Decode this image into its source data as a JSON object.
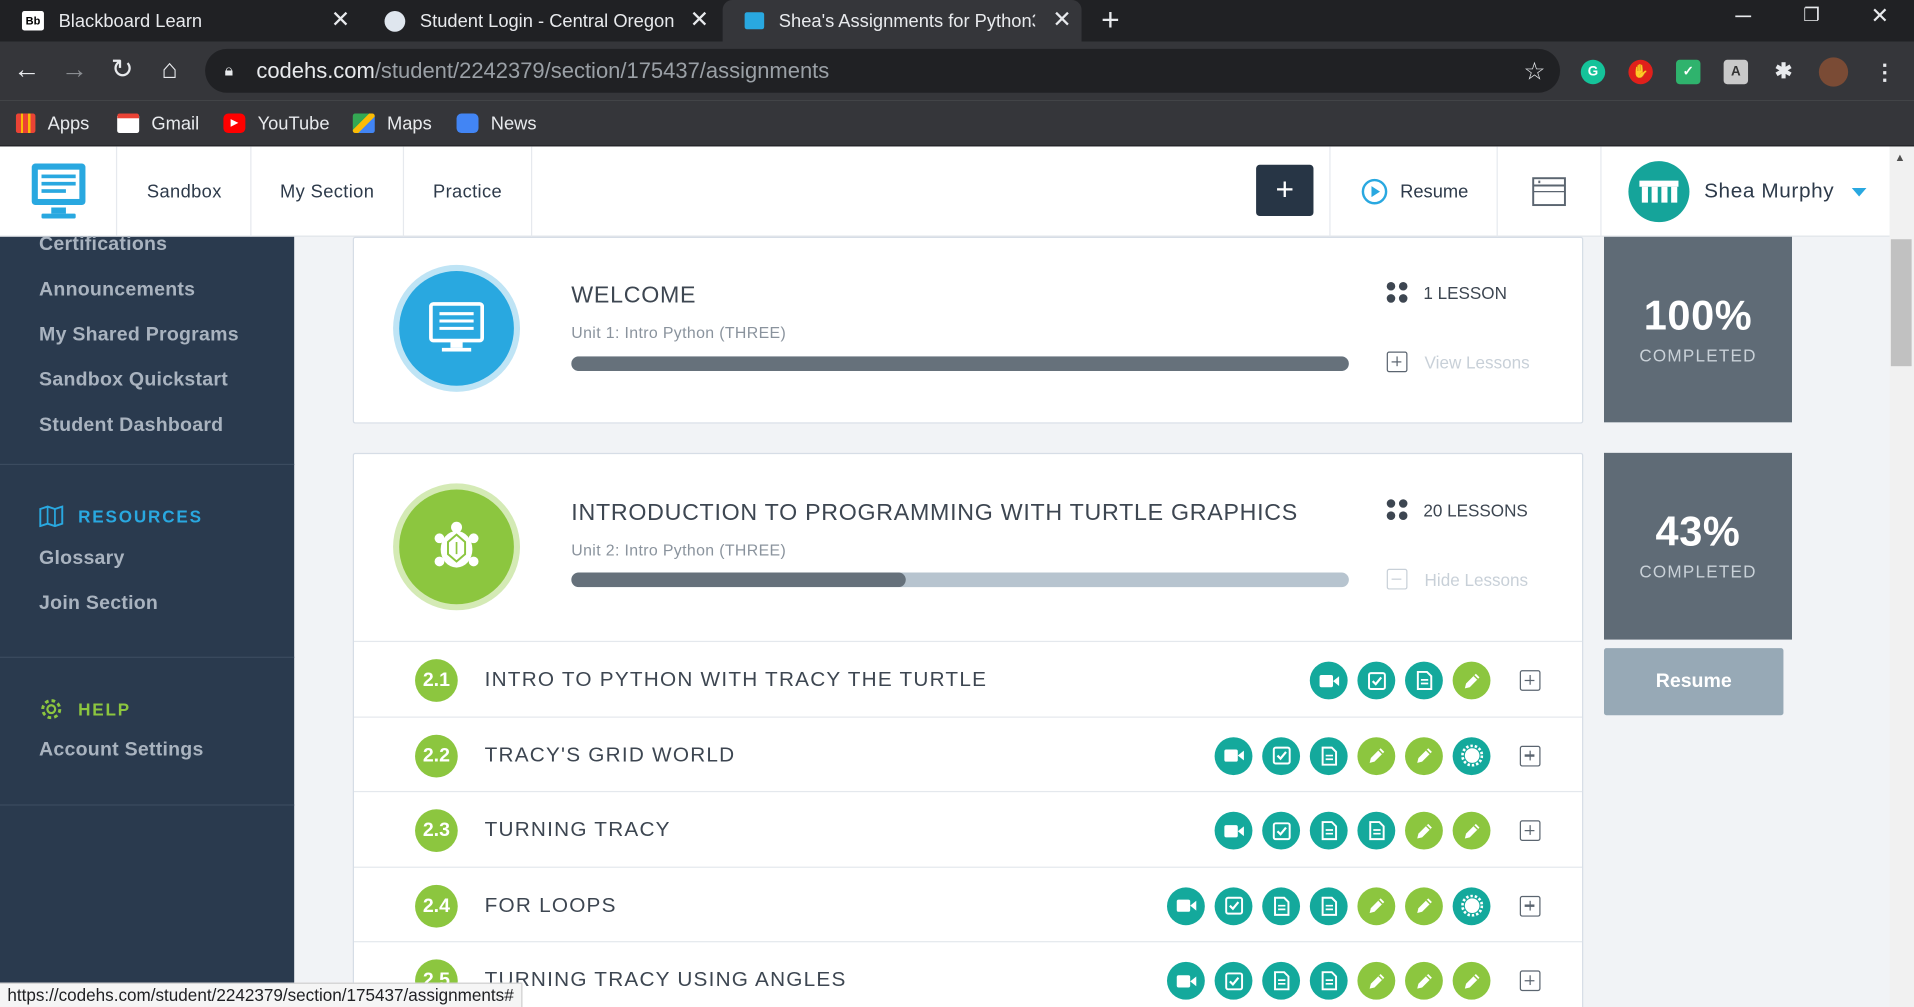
{
  "browser": {
    "tabs": [
      {
        "title": "Blackboard Learn",
        "favicon": "Bb"
      },
      {
        "title": "Student Login - Central Oregon C",
        "favicon": "globe"
      },
      {
        "title": "Shea's Assignments for Python3 |",
        "favicon": "codehs"
      }
    ],
    "url_host": "codehs.com",
    "url_path": "/student/2242379/section/175437/assignments",
    "bookmarks": [
      {
        "label": "Apps",
        "icon": "apps-grid-icon"
      },
      {
        "label": "Gmail",
        "icon": "gmail-icon"
      },
      {
        "label": "YouTube",
        "icon": "youtube-icon"
      },
      {
        "label": "Maps",
        "icon": "maps-icon"
      },
      {
        "label": "News",
        "icon": "news-icon"
      }
    ],
    "status_url": "https://codehs.com/student/2242379/section/175437/assignments#"
  },
  "header": {
    "nav": [
      "Sandbox",
      "My Section",
      "Practice"
    ],
    "plus_label": "+",
    "resume_label": "Resume",
    "user_name": "Shea Murphy"
  },
  "sidebar": {
    "items_top": [
      "Certifications",
      "Announcements",
      "My Shared Programs",
      "Sandbox Quickstart",
      "Student Dashboard"
    ],
    "resources_heading": "RESOURCES",
    "resources_items": [
      "Glossary",
      "Join Section"
    ],
    "help_heading": "HELP",
    "help_items": [
      "Account Settings"
    ]
  },
  "units": [
    {
      "title": "WELCOME",
      "subtitle": "Unit 1: Intro Python (THREE)",
      "progress": 1.0,
      "lesson_count": "1 LESSON",
      "toggle_label": "View Lessons",
      "percent": "100%",
      "percent_label": "COMPLETED"
    },
    {
      "title": "INTRODUCTION TO PROGRAMMING WITH TURTLE GRAPHICS",
      "subtitle": "Unit 2: Intro Python (THREE)",
      "progress": 0.43,
      "lesson_count": "20 LESSONS",
      "toggle_label": "Hide Lessons",
      "percent": "43%",
      "percent_label": "COMPLETED",
      "resume_label": "Resume"
    }
  ],
  "lessons": [
    {
      "num": "2.1",
      "name": "INTRO TO PYTHON WITH TRACY THE TURTLE",
      "activities": [
        "video",
        "quiz",
        "doc",
        "pencil"
      ]
    },
    {
      "num": "2.2",
      "name": "TRACY'S GRID WORLD",
      "activities": [
        "video",
        "quiz",
        "doc",
        "pencil",
        "pencil",
        "badge"
      ]
    },
    {
      "num": "2.3",
      "name": "TURNING TRACY",
      "activities": [
        "video",
        "quiz",
        "doc",
        "doc",
        "pencil",
        "pencil"
      ]
    },
    {
      "num": "2.4",
      "name": "FOR LOOPS",
      "activities": [
        "video",
        "quiz",
        "doc",
        "doc",
        "pencil",
        "pencil",
        "badge"
      ]
    },
    {
      "num": "2.5",
      "name": "TURNING TRACY USING ANGLES",
      "activities": [
        "video",
        "quiz",
        "doc",
        "doc",
        "pencil",
        "pencil",
        "pencil"
      ]
    }
  ],
  "colors": {
    "sidebar": "#2a3a4e",
    "teal": "#14a99c",
    "green": "#8cc63f",
    "blue": "#29a8e0",
    "progress_dark": "#66717b"
  }
}
